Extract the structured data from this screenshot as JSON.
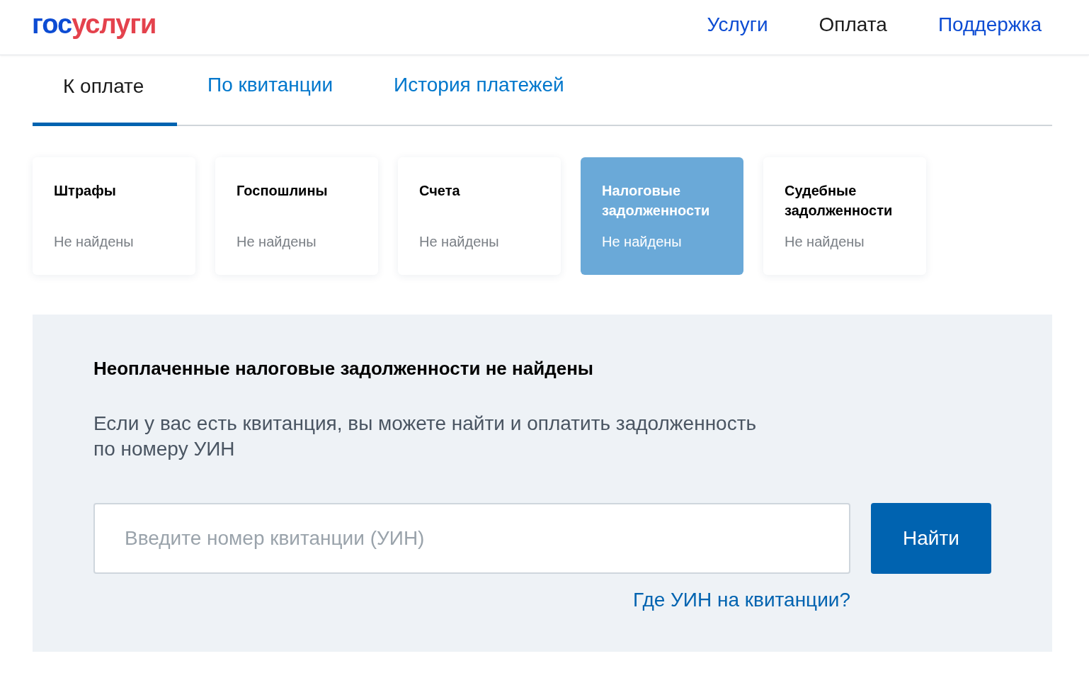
{
  "header": {
    "logo": [
      {
        "text": "гос",
        "color": "#0d4cd3"
      },
      {
        "text": "услуги",
        "color": "#e4424d"
      }
    ],
    "nav": [
      {
        "label": "Услуги",
        "selected": false
      },
      {
        "label": "Оплата",
        "selected": true
      },
      {
        "label": "Поддержка",
        "selected": false
      }
    ]
  },
  "tabs": [
    {
      "label": "К оплате",
      "selected": true
    },
    {
      "label": "По квитанции",
      "selected": false
    },
    {
      "label": "История платежей",
      "selected": false
    }
  ],
  "categories": [
    {
      "title": "Штрафы",
      "status": "Не найдены",
      "selected": false
    },
    {
      "title": "Госпошлины",
      "status": "Не найдены",
      "selected": false
    },
    {
      "title": "Счета",
      "status": "Не найдены",
      "selected": false
    },
    {
      "title": "Налоговые задолженности",
      "status": "Не найдены",
      "selected": true
    },
    {
      "title": "Судебные задолженности",
      "status": "Не найдены",
      "selected": false
    }
  ],
  "panel": {
    "heading": "Неоплаченные налоговые задолженности не найдены",
    "text": "Если у вас есть квитанция, вы можете найти и оплатить задолженность по номеру УИН",
    "search": {
      "placeholder": "Введите номер квитанции (УИН)"
    },
    "button": "Найти",
    "help_link": "Где УИН на квитанции?"
  }
}
